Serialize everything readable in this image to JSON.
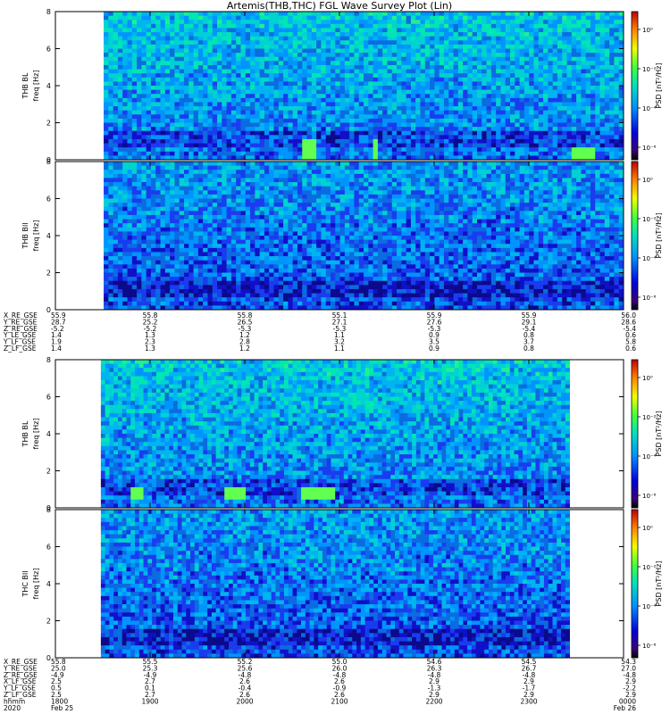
{
  "title": "Artemis(THB,THC) FGL Wave Survey Plot (Lin)",
  "colors": {
    "background": "#ffffff",
    "axis": "#000000",
    "no_data": "#ffffff"
  },
  "chart_data": [
    {
      "type": "heatmap",
      "panel": "THB BL",
      "ylabel": "THB BL",
      "yunit": "freq [Hz]",
      "ylim": [
        0,
        8
      ],
      "yticks": [
        "0",
        "2",
        "4",
        "6",
        "8"
      ],
      "colorbar_label": "PSD [nT²/Hz]",
      "colorbar_ticks": [
        "10⁰",
        "10⁻²",
        "10⁻⁴",
        "10⁻⁶"
      ],
      "data_start_fraction": 0.085,
      "data_end_fraction": 1.0,
      "features": [
        "dense low-frequency band below ~1 Hz",
        "elevated PSD near 0.5 Hz around 55.8 and 55.9 intervals"
      ]
    },
    {
      "type": "heatmap",
      "panel": "THB Bll",
      "ylabel": "THB Bll",
      "yunit": "freq [Hz]",
      "ylim": [
        0,
        8
      ],
      "yticks": [
        "0",
        "2",
        "4",
        "6",
        "8"
      ],
      "colorbar_label": "PSD [nT²/Hz]",
      "colorbar_ticks": [
        "10⁰",
        "10⁻²",
        "10⁻⁴",
        "10⁻⁶"
      ],
      "data_start_fraction": 0.085,
      "data_end_fraction": 1.0
    },
    {
      "type": "heatmap",
      "panel": "THB BL (THC)",
      "ylabel": "THB BL",
      "yunit": "freq [Hz]",
      "ylim": [
        0,
        8
      ],
      "yticks": [
        "0",
        "2",
        "4",
        "6",
        "8"
      ],
      "colorbar_label": "PSD [nT²/Hz]",
      "colorbar_ticks": [
        "10⁰",
        "10⁻²",
        "10⁻⁴",
        "10⁻⁶"
      ],
      "data_start_fraction": 0.08,
      "data_end_fraction": 0.905,
      "features": [
        "enhanced band near 0.6-0.9 Hz around 2100 hhmm"
      ]
    },
    {
      "type": "heatmap",
      "panel": "THC Bll",
      "ylabel": "THC Bll",
      "yunit": "freq [Hz]",
      "ylim": [
        0,
        8
      ],
      "yticks": [
        "0",
        "2",
        "4",
        "6",
        "8"
      ],
      "colorbar_label": "PSD [nT²/Hz]",
      "colorbar_ticks": [
        "10⁰",
        "10⁻²",
        "10⁻⁴",
        "10⁻⁶"
      ],
      "data_start_fraction": 0.08,
      "data_end_fraction": 0.905
    }
  ],
  "ephemeris_top": {
    "labels": [
      "X_RE_GSE",
      "Y_RE_GSE",
      "Z_RE_GSE",
      "Y_LE_GSE",
      "Y_LF_GSE",
      "Z_LF_GSE"
    ],
    "columns": [
      [
        "55.9",
        "28.7",
        "-5.2",
        "1.4",
        "1.9",
        "1.4"
      ],
      [
        "55.8",
        "25.2",
        "-5.2",
        "1.3",
        "2.3",
        "1.3"
      ],
      [
        "55.8",
        "26.5",
        "-5.3",
        "1.2",
        "2.8",
        "1.2"
      ],
      [
        "55.1",
        "27.1",
        "-5.3",
        "1.1",
        "3.2",
        "1.1"
      ],
      [
        "55.9",
        "27.6",
        "-5.3",
        "0.9",
        "3.5",
        "0.9"
      ],
      [
        "55.9",
        "29.1",
        "-5.4",
        "0.8",
        "3.7",
        "0.8"
      ],
      [
        "56.0",
        "28.6",
        "-5.4",
        "0.6",
        "5.8",
        "0.6"
      ]
    ]
  },
  "ephemeris_bottom": {
    "labels": [
      "X_RE_GSE",
      "Y_RE_GSE",
      "Z_RE_GSE",
      "X_LF_GSE",
      "Y_LF_GSE",
      "Z_LF_GSE",
      "hhmm",
      "2020"
    ],
    "columns": [
      [
        "55.8",
        "25.0",
        "-4.9",
        "2.5",
        "0.5",
        "2.5",
        "1800",
        "Feb 25"
      ],
      [
        "55.5",
        "25.3",
        "-4.9",
        "2.7",
        "0.1",
        "2.7",
        "1900",
        ""
      ],
      [
        "55.2",
        "25.6",
        "-4.8",
        "2.6",
        "-0.4",
        "2.6",
        "2000",
        ""
      ],
      [
        "55.0",
        "26.0",
        "-4.8",
        "2.6",
        "-0.9",
        "2.6",
        "2100",
        ""
      ],
      [
        "54.6",
        "26.3",
        "-4.8",
        "2.9",
        "-1.3",
        "2.9",
        "2200",
        ""
      ],
      [
        "54.5",
        "26.7",
        "-4.8",
        "2.9",
        "-1.7",
        "2.9",
        "2300",
        ""
      ],
      [
        "54.3",
        "27.0",
        "-4.8",
        "2.9",
        "-2.2",
        "2.9",
        "0000",
        "Feb 26"
      ]
    ]
  }
}
